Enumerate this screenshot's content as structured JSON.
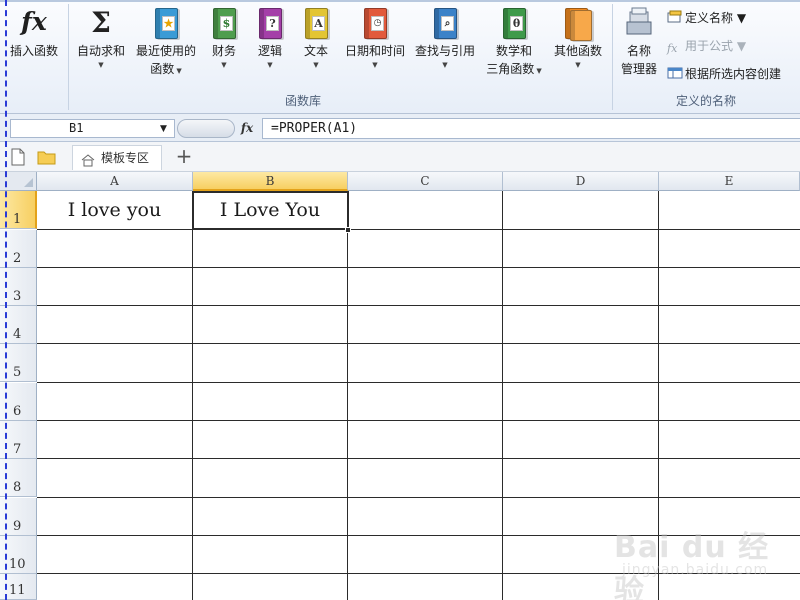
{
  "ribbon": {
    "buttons": [
      {
        "label": "插入函数",
        "line2": ""
      },
      {
        "label": "自动求和",
        "line2": ""
      },
      {
        "label": "最近使用的",
        "line2": "函数"
      },
      {
        "label": "财务",
        "line2": ""
      },
      {
        "label": "逻辑",
        "line2": ""
      },
      {
        "label": "文本",
        "line2": ""
      },
      {
        "label": "日期和时间",
        "line2": ""
      },
      {
        "label": "查找与引用",
        "line2": ""
      },
      {
        "label": "数学和",
        "line2": "三角函数"
      },
      {
        "label": "其他函数",
        "line2": ""
      },
      {
        "label": "名称",
        "line2": "管理器"
      }
    ],
    "small_items": {
      "define_name": "定义名称",
      "use_in_formula": "用于公式",
      "create_from_selection": "根据所选内容创建"
    },
    "groups": {
      "function_library": "函数库",
      "defined_names": "定义的名称"
    },
    "icons": {
      "insert_function": "fx",
      "autosum": "Σ",
      "logic": "?",
      "text": "A",
      "math": "θ"
    },
    "colors": {
      "recent": "#3a9bd6",
      "financial": "#4f9d4e",
      "logic": "#a43fa8",
      "text": "#e3c533",
      "datetime": "#e25a3c",
      "lookup": "#3b82c8",
      "math": "#3f9a4a",
      "other": "#f18a21"
    }
  },
  "formula_bar": {
    "cell_ref": "B1",
    "fx_label": "fx",
    "formula": "=PROPER(A1)"
  },
  "tabs": {
    "template_tab": "模板专区",
    "add": "+"
  },
  "grid": {
    "columns": [
      "A",
      "B",
      "C",
      "D",
      "E"
    ],
    "rows": [
      "1",
      "2",
      "3",
      "4",
      "5",
      "6",
      "7",
      "8",
      "9",
      "10",
      "11"
    ],
    "active_cell": "B1",
    "cells": {
      "A1": "I love you",
      "B1": "I Love You"
    }
  },
  "watermark": {
    "line1": "Bai du 经验",
    "line2": "jingyan.baidu.com"
  }
}
